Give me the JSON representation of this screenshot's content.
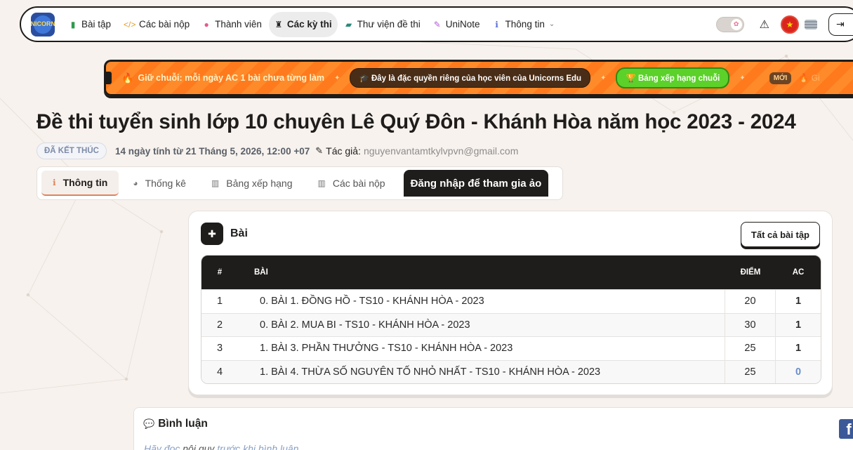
{
  "brand": {
    "logo_text": "UNICORNS"
  },
  "nav": {
    "items": [
      {
        "label": "Bài tập",
        "icon": "book-icon",
        "glyph": "▮",
        "color": "#2e9a4e"
      },
      {
        "label": "Các bài nộp",
        "icon": "code-icon",
        "glyph": "</>",
        "color": "#e0a02a"
      },
      {
        "label": "Thành viên",
        "icon": "users-icon",
        "glyph": "●",
        "color": "#e35b8f"
      },
      {
        "label": "Các kỳ thi",
        "icon": "trophy-icon",
        "glyph": "🏆",
        "color": "#222"
      },
      {
        "label": "Thư viện đề thi",
        "icon": "folder-icon",
        "glyph": "▰",
        "color": "#2a8a7a"
      },
      {
        "label": "UniNote",
        "icon": "pen-icon",
        "glyph": "✎",
        "color": "#b65ad6"
      },
      {
        "label": "Thông tin",
        "icon": "info-icon",
        "glyph": "ℹ",
        "color": "#5b6fd6"
      }
    ]
  },
  "banner": {
    "streak_text": "Giữ chuỗi: mỗi ngày AC 1 bài chưa từng làm",
    "privilege_text": "Đây là đặc quyền riêng của học viên của Unicorns Edu",
    "leaderboard_text": "Bảng xếp hạng chuỗi",
    "new_badge": "MỚI",
    "trailing_text": "Gi"
  },
  "contest": {
    "title": "Đề thi tuyển sinh lớp 10 chuyên Lê Quý Đôn - Khánh Hòa năm học 2023 - 2024",
    "status": "ĐÃ KẾT THÚC",
    "time_info": "14 ngày tính từ 21 Tháng 5, 2026, 12:00 +07",
    "author_label": "Tác giả:",
    "author": "nguyenvantamtkylvpvn@gmail.com"
  },
  "tabs": [
    {
      "label": "Thông tin",
      "icon": "info-circle-icon",
      "glyph": "ℹ"
    },
    {
      "label": "Thống kê",
      "icon": "pie-chart-icon",
      "glyph": "◕"
    },
    {
      "label": "Bảng xếp hạng",
      "icon": "bar-chart-icon",
      "glyph": "▥"
    },
    {
      "label": "Các bài nộp",
      "icon": "bar-chart-icon",
      "glyph": "▥"
    },
    {
      "label": "Đăng nhập để tham gia ảo",
      "icon": "",
      "glyph": ""
    }
  ],
  "problems": {
    "title": "Bài",
    "all_button": "Tất cả bài tập",
    "columns": {
      "num": "#",
      "name": "BÀI",
      "score": "ĐIỂM",
      "ac": "AC"
    },
    "rows": [
      {
        "num": "1",
        "name": "0. BÀI 1. ĐỒNG HỒ - TS10 - KHÁNH HÒA - 2023",
        "score": "20",
        "ac": "1"
      },
      {
        "num": "2",
        "name": "0. BÀI 2. MUA BI - TS10 - KHÁNH HÒA - 2023",
        "score": "30",
        "ac": "1"
      },
      {
        "num": "3",
        "name": "1. BÀI 3. PHẦN THƯỞNG - TS10 - KHÁNH HÒA - 2023",
        "score": "25",
        "ac": "1"
      },
      {
        "num": "4",
        "name": "1. BÀI 4. THỪA SỐ NGUYÊN TỐ NHỎ NHẤT - TS10 - KHÁNH HÒA - 2023",
        "score": "25",
        "ac": "0"
      }
    ]
  },
  "comments": {
    "title": "Bình luận",
    "hint_prefix": "Hãy đọc",
    "hint_link": "nội quy",
    "hint_suffix": "trước khi bình luận."
  },
  "colors": {
    "accent": "#e0825a",
    "banner": "#ff8a2a",
    "dark": "#1f1d1b"
  }
}
